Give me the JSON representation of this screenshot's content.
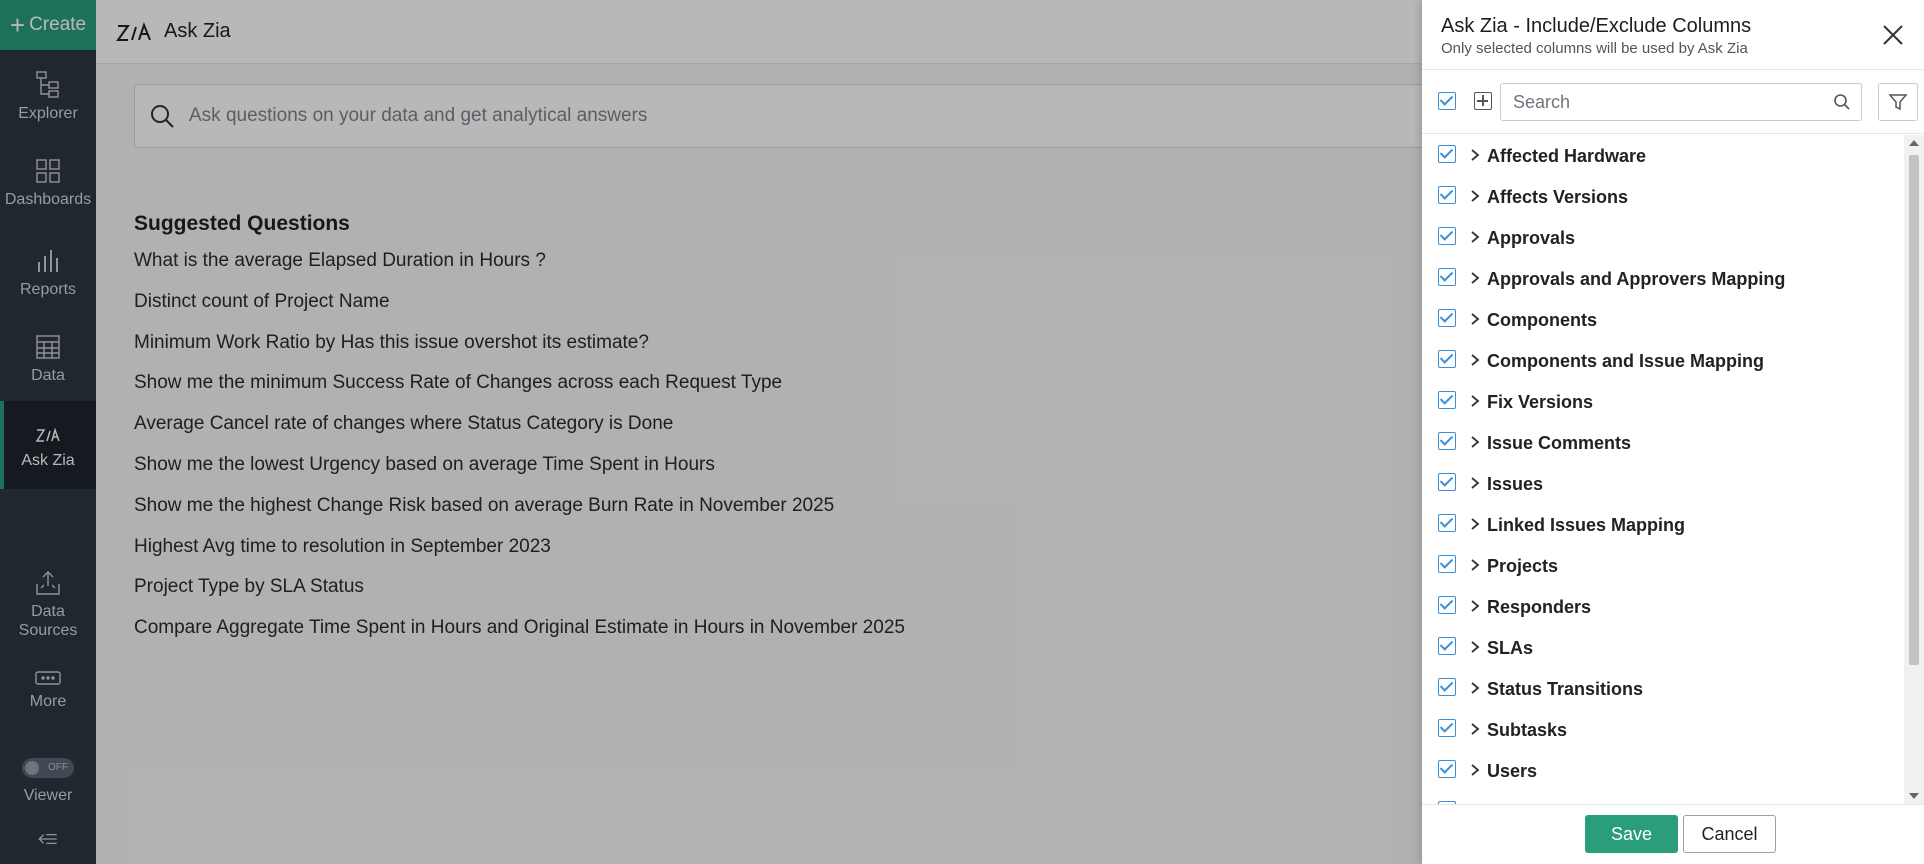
{
  "nav": {
    "create_label": "Create",
    "items": [
      {
        "label": "Explorer",
        "icon": "explorer-icon"
      },
      {
        "label": "Dashboards",
        "icon": "dashboards-icon"
      },
      {
        "label": "Reports",
        "icon": "reports-icon"
      },
      {
        "label": "Data",
        "icon": "data-icon"
      },
      {
        "label": "Ask Zia",
        "icon": "zia-icon"
      },
      {
        "label": "Data Sources",
        "icon": "data-sources-icon"
      },
      {
        "label": "More",
        "icon": "more-icon"
      },
      {
        "label": "Viewer",
        "icon": "toggle-icon"
      }
    ],
    "viewer_toggle_text": "OFF",
    "active": "Ask Zia"
  },
  "header": {
    "title": "Ask Zia"
  },
  "ask": {
    "placeholder": "Ask questions on your data and get analytical answers"
  },
  "suggested": {
    "title": "Suggested Questions",
    "items": [
      "What is the average Elapsed Duration in Hours ?",
      "Distinct count of Project Name",
      "Minimum Work Ratio by Has this issue overshot its estimate?",
      "Show me the minimum Success Rate of Changes across each Request Type",
      "Average Cancel rate of changes where Status Category is Done",
      "Show me the lowest Urgency based on average Time Spent in Hours",
      "Show me the highest Change Risk based on average Burn Rate in November 2025",
      "Highest Avg time to resolution in September 2023",
      "Project Type by SLA Status",
      "Compare Aggregate Time Spent in Hours and Original Estimate in Hours in November 2025"
    ]
  },
  "panel": {
    "title": "Ask Zia - Include/Exclude Columns",
    "subtitle": "Only selected columns will be used by Ask Zia",
    "search_placeholder": "Search",
    "tables": [
      "Affected Hardware",
      "Affects Versions",
      "Approvals",
      "Approvals and Approvers Mapping",
      "Components",
      "Components and Issue Mapping",
      "Fix Versions",
      "Issue Comments",
      "Issues",
      "Linked Issues Mapping",
      "Projects",
      "Responders",
      "SLAs",
      "Status Transitions",
      "Subtasks",
      "Users"
    ],
    "save_label": "Save",
    "cancel_label": "Cancel"
  },
  "colors": {
    "accent": "#2a9d7c",
    "sidebar": "#2e3642",
    "checkbox": "#3a8fd6"
  }
}
